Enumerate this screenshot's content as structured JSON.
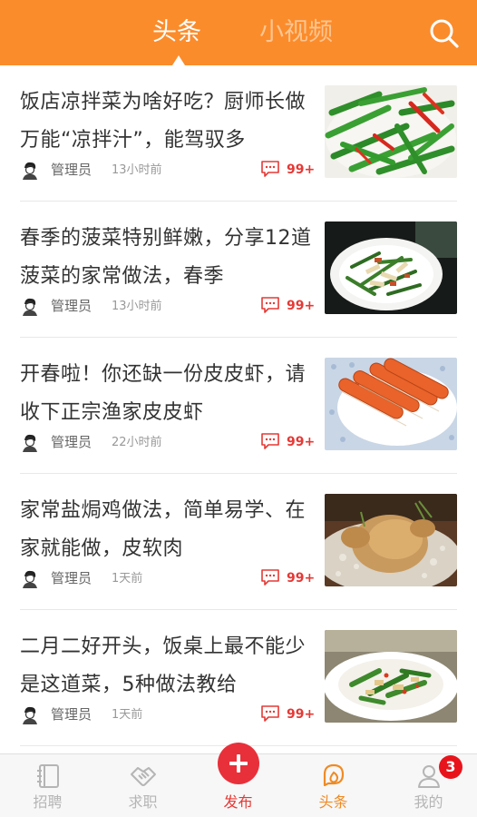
{
  "header": {
    "tabs": [
      {
        "label": "头条",
        "active": true
      },
      {
        "label": "小视频",
        "active": false
      }
    ],
    "search_icon": "search-icon",
    "colors": {
      "bar": "#fb8c2b",
      "active_tab": "#ffffff",
      "inactive_tab": "#ffc592"
    }
  },
  "feed": {
    "items": [
      {
        "title": "饭店凉拌菜为啥好吃？厨师长做万能“凉拌汁”，能驾驭多",
        "author": "管理员",
        "time": "13小时前",
        "comments": "99+",
        "thumb": "green-beans-chili-dish"
      },
      {
        "title": "春季的菠菜特别鲜嫩，分享12道菠菜的家常做法，春季",
        "author": "管理员",
        "time": "13小时前",
        "comments": "99+",
        "thumb": "spinach-tofu-skin-plate"
      },
      {
        "title": "开春啦！你还缺一份皮皮虾，请收下正宗渔家皮皮虾",
        "author": "管理员",
        "time": "22小时前",
        "comments": "99+",
        "thumb": "mantis-shrimp-plate"
      },
      {
        "title": "家常盐焗鸡做法，简单易学、在家就能做，皮软肉",
        "author": "管理员",
        "time": "1天前",
        "comments": "99+",
        "thumb": "salt-baked-chicken"
      },
      {
        "title": "二月二好开头，饭桌上最不能少是这道菜，5种做法教给",
        "author": "管理员",
        "time": "1天前",
        "comments": "99+",
        "thumb": "stir-fried-greens-dish"
      }
    ]
  },
  "bottom_nav": {
    "items": [
      {
        "label": "招聘",
        "icon": "recruit-icon"
      },
      {
        "label": "求职",
        "icon": "handshake-icon"
      },
      {
        "label": "发布",
        "icon": "plus-icon"
      },
      {
        "label": "头条",
        "icon": "headlines-icon",
        "active": true
      },
      {
        "label": "我的",
        "icon": "user-icon"
      }
    ],
    "badge": "3",
    "colors": {
      "active": "#f08a24",
      "inactive": "#b5b5b5",
      "publish": "#e8303a"
    }
  }
}
